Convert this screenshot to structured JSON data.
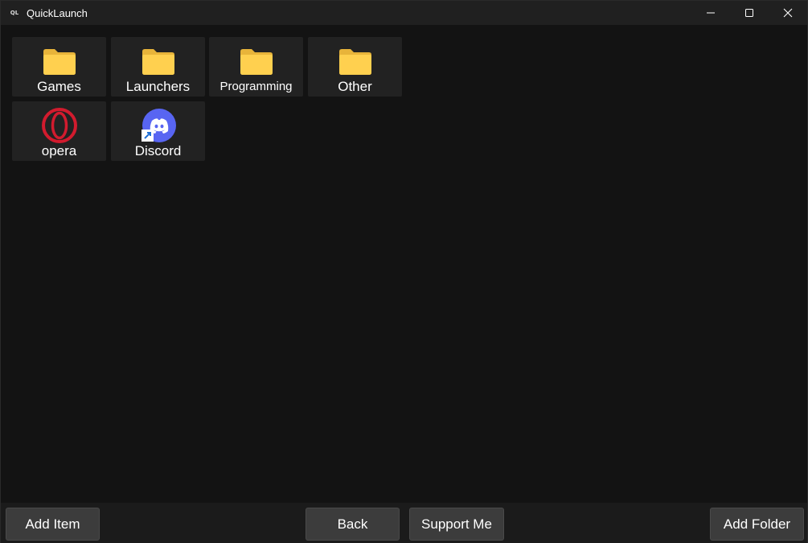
{
  "window": {
    "app_icon_text": "QL",
    "title": "QuickLaunch",
    "controls": {
      "minimize_icon": "minimize-icon",
      "maximize_icon": "maximize-icon",
      "close_icon": "close-icon"
    }
  },
  "tiles": [
    {
      "label": "Games",
      "icon": "folder-icon"
    },
    {
      "label": "Launchers",
      "icon": "folder-icon"
    },
    {
      "label": "Programming",
      "icon": "folder-icon"
    },
    {
      "label": "Other",
      "icon": "folder-icon"
    },
    {
      "label": "opera",
      "icon": "opera-icon"
    },
    {
      "label": "Discord",
      "icon": "discord-icon"
    }
  ],
  "bottom_bar": {
    "add_item_label": "Add Item",
    "back_label": "Back",
    "support_label": "Support Me",
    "add_folder_label": "Add Folder"
  },
  "colors": {
    "background": "#131313",
    "titlebar": "#202020",
    "tile": "#222222",
    "folder": "#ffd04f",
    "opera": "#d21b2e",
    "discord": "#5865f2",
    "button": "#3c3c3c"
  }
}
